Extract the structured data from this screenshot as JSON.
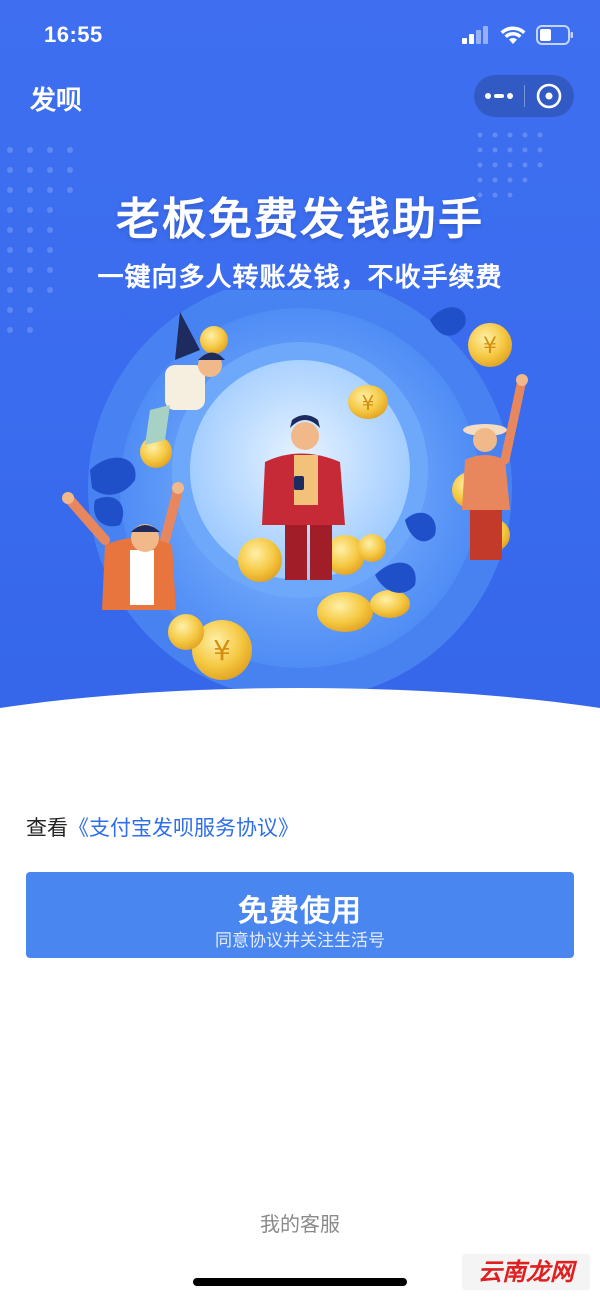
{
  "status_bar": {
    "time": "16:55"
  },
  "nav": {
    "title": "发呗",
    "more_icon": "more-dots-icon",
    "close_icon": "close-circle-icon"
  },
  "hero": {
    "headline": "老板免费发钱助手",
    "subline": "一键向多人转账发钱，不收手续费"
  },
  "agreement": {
    "prefix": "查看",
    "link": "《支付宝发呗服务协议》"
  },
  "cta": {
    "label": "免费使用",
    "sublabel": "同意协议并关注生活号"
  },
  "footer": {
    "service_link": "我的客服"
  },
  "watermark": {
    "text": "云南龙网"
  },
  "colors": {
    "hero_blue": "#3f6ff0",
    "button_blue": "#4a86f0",
    "link_blue": "#2f6fea",
    "coin_gold": "#f5c842"
  }
}
